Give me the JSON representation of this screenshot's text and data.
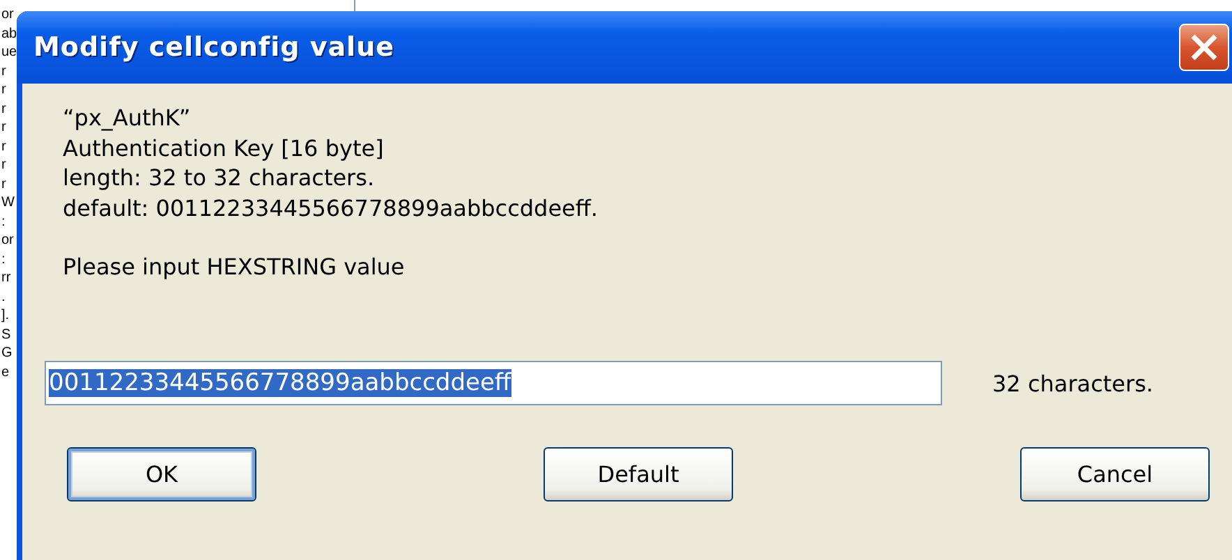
{
  "background_window": {
    "lines": [
      "or",
      "ab",
      "ue",
      "r",
      "r",
      "r",
      "r",
      "r",
      "r",
      "r",
      "W",
      ":",
      "or",
      ":",
      "rr",
      ".",
      "].",
      "S",
      "G",
      "e"
    ]
  },
  "dialog": {
    "title": "Modify cellconfig value",
    "description": [
      "“px_AuthK”",
      "Authentication Key [16 byte]",
      "length: 32 to 32 characters.",
      "default: 00112233445566778899aabbccddeeff."
    ],
    "prompt": "Please input HEXSTRING value",
    "input": {
      "value": "00112233445566778899aabbccddeeff",
      "selected": true
    },
    "char_count": "32 characters.",
    "buttons": [
      {
        "label": "OK",
        "default": true
      },
      {
        "label": "Default",
        "default": false
      },
      {
        "label": "Cancel",
        "default": false
      }
    ]
  }
}
